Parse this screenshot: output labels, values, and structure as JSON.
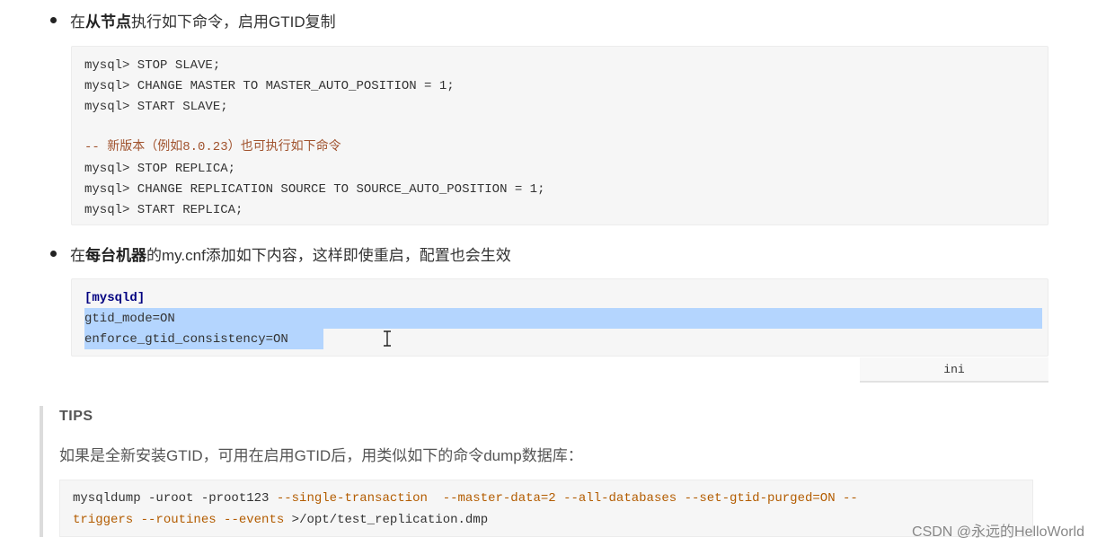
{
  "bullet1": {
    "pre": "在",
    "bold": "从节点",
    "post": "执行如下命令，启用GTID复制"
  },
  "code1": {
    "lines": [
      {
        "text": "mysql> STOP SLAVE;",
        "kind": "code"
      },
      {
        "text": "mysql> CHANGE MASTER TO MASTER_AUTO_POSITION = 1;",
        "kind": "code"
      },
      {
        "text": "mysql> START SLAVE;",
        "kind": "code"
      },
      {
        "text": "-- 新版本（例如8.0.23）也可执行如下命令",
        "kind": "comment"
      },
      {
        "text": "mysql> STOP REPLICA;",
        "kind": "code"
      },
      {
        "text": "mysql> CHANGE REPLICATION SOURCE TO SOURCE_AUTO_POSITION = 1;",
        "kind": "code"
      },
      {
        "text": "mysql> START REPLICA;",
        "kind": "code"
      }
    ]
  },
  "bullet2": {
    "pre": "在",
    "bold": "每台机器",
    "post": "的my.cnf添加如下内容，这样即使重启，配置也会生效"
  },
  "code2": {
    "lines": [
      {
        "text": "[mysqld]",
        "kind": "section"
      },
      {
        "text": "gtid_mode=ON",
        "kind": "selected"
      },
      {
        "text": "enforce_gtid_consistency=ON",
        "kind": "selected"
      }
    ],
    "language": "ini"
  },
  "tips": {
    "title": "TIPS",
    "text": "如果是全新安装GTID，可用在启用GTID后，用类似如下的命令dump数据库：",
    "code": {
      "line1": {
        "cmd": "mysqldump -uroot -proot123 ",
        "opt1": "--single-transaction",
        "sp1": "  ",
        "opt2": "--master-data=2",
        "sp2": " ",
        "opt3": "--all-databases",
        "sp3": " ",
        "opt4": "--set-gtid-purged=ON",
        "sp4": " ",
        "opt5": "--"
      },
      "line2": {
        "opt1": "triggers",
        "sp1": " ",
        "opt2": "--routines",
        "sp2": " ",
        "opt3": "--events",
        "rest": " >/opt/test_replication.dmp"
      }
    }
  },
  "watermark": "CSDN @永远的HelloWorld",
  "colors": {
    "selection": "#b4d5fe",
    "comment": "#a0522d",
    "section": "#000080",
    "option": "#b35c00",
    "code_bg": "#f6f6f6"
  }
}
